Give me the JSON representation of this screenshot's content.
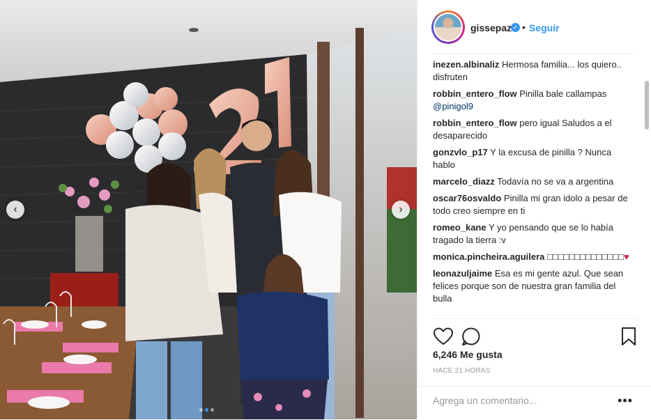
{
  "post": {
    "author": {
      "username": "gissepaz",
      "verified_icon": "verified-badge-icon",
      "follow_separator": "•",
      "follow_label": "Seguir"
    },
    "comments": [
      {
        "user": "inezen.albinaliz",
        "text": "Hermosa familia... los quiero.. disfruten"
      },
      {
        "user": "robbin_entero_flow",
        "text": "Pinilla bale callampas",
        "mention": "@pinigol9"
      },
      {
        "user": "robbin_entero_flow",
        "text": "pero igual Saludos a el desaparecido"
      },
      {
        "user": "gonzvlo_p17",
        "text": "Y la excusa de pinilla ? Nunca hablo"
      },
      {
        "user": "marcelo_diazz",
        "text": "Todavía no se va a argentina"
      },
      {
        "user": "oscar76osvaldo",
        "text": "Pinilla mi gran idolo a pesar de todo creo siempre en ti"
      },
      {
        "user": "romeo_kane",
        "text": "Y yo pensando que se lo había tragado la tierra :v"
      },
      {
        "user": "monica.pincheira.aguilera",
        "text": "□□□□□□□□□□□□□□",
        "emoji": "♥"
      },
      {
        "user": "leonazuljaime",
        "text": "Esa es mi gente azul. Que sean felices porque son de nuestra gran familia del bulla"
      }
    ],
    "likes": "6,246 Me gusta",
    "timestamp": "HACE 21 HORAS",
    "add_comment_placeholder": "Agrega un comentario...",
    "more_label": "•••",
    "nav": {
      "prev": "‹",
      "next": "›"
    },
    "carousel": {
      "count": 3,
      "active": 2
    }
  },
  "colors": {
    "accent": "#3897f0",
    "text": "#262626",
    "muted": "#999999",
    "heart": "#c0284a"
  }
}
